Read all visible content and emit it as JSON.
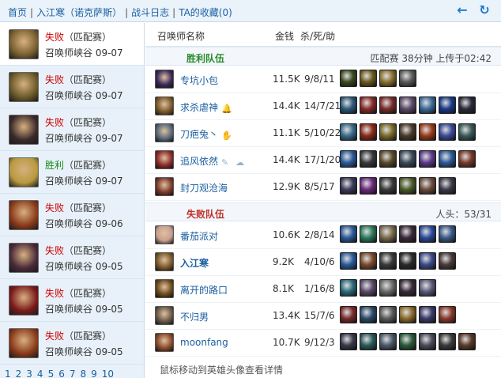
{
  "breadcrumb": {
    "home": "首页",
    "player": "入江寒（诺克萨斯）",
    "battle_log": "战斗日志",
    "favorites": "TA的收藏(0)"
  },
  "nav": {
    "back_icon": "arrow-left-icon",
    "refresh_icon": "refresh-icon"
  },
  "games": [
    {
      "result": "失败",
      "mode": "（匹配赛）",
      "info": "召唤师峡谷 09-07",
      "outcome": "loss",
      "color": "#7a6030"
    },
    {
      "result": "失败",
      "mode": "（匹配赛）",
      "info": "召唤师峡谷 09-07",
      "outcome": "loss",
      "color": "#6a5a2a"
    },
    {
      "result": "失败",
      "mode": "（匹配赛）",
      "info": "召唤师峡谷 09-07",
      "outcome": "loss",
      "color": "#3a2a2a"
    },
    {
      "result": "胜利",
      "mode": "（匹配赛）",
      "info": "召唤师峡谷 09-07",
      "outcome": "win",
      "color": "#b89a40"
    },
    {
      "result": "失败",
      "mode": "（匹配赛）",
      "info": "召唤师峡谷 09-06",
      "outcome": "loss",
      "color": "#8a3a1a"
    },
    {
      "result": "失败",
      "mode": "（匹配赛）",
      "info": "召唤师峡谷 09-05",
      "outcome": "loss",
      "color": "#4a2a3a"
    },
    {
      "result": "失败",
      "mode": "（匹配赛）",
      "info": "召唤师峡谷 09-05",
      "outcome": "loss",
      "color": "#7a1a1a"
    },
    {
      "result": "失败",
      "mode": "（匹配赛）",
      "info": "召唤师峡谷 09-05",
      "outcome": "loss",
      "color": "#8a3a1a"
    }
  ],
  "pager": [
    "1",
    "2",
    "3",
    "4",
    "5",
    "6",
    "7",
    "8",
    "9",
    "10"
  ],
  "columns": {
    "name": "召唤师名称",
    "gold": "金钱",
    "kda": "杀/死/助"
  },
  "win_team": {
    "label": "胜利队伍",
    "meta": "匹配赛 38分钟 上传于02:42",
    "players": [
      {
        "name": "专坑小包",
        "gold": "11.5K",
        "kda": "9/8/11",
        "badges": [],
        "champ_color": "#3a2a5a",
        "items": [
          "#3a4a20",
          "#6a5a20",
          "#8a7030",
          "#5a5a5a"
        ]
      },
      {
        "name": "求杀虐神",
        "gold": "14.4K",
        "kda": "14/7/21",
        "badges": [
          "bell-icon"
        ],
        "champ_color": "#7a5a2a",
        "items": [
          "#2a5a7a",
          "#8a2a2a",
          "#7a2a2a",
          "#5a4a6a",
          "#3a6a9a",
          "#1a3a8a",
          "#2a2a3a"
        ]
      },
      {
        "name": "刀疤兔丶",
        "gold": "11.1K",
        "kda": "5/10/22",
        "badges": [
          "hand-icon"
        ],
        "champ_color": "#5a6a7a",
        "items": [
          "#3a6a8a",
          "#8a2a1a",
          "#7a6a2a",
          "#4a3a2a",
          "#9a3a1a",
          "#3a4a9a",
          "#3a5a5a"
        ]
      },
      {
        "name": "追风依然",
        "gold": "14.4K",
        "kda": "17/1/20",
        "badges": [
          "feather-icon",
          "cloud-icon"
        ],
        "champ_color": "#8a2a2a",
        "items": [
          "#2a5a9a",
          "#3a3a3a",
          "#5a4a2a",
          "#3a4a5a",
          "#5a3a8a",
          "#2a5a9a",
          "#7a3a2a"
        ]
      },
      {
        "name": "封刀观沧海",
        "gold": "12.9K",
        "kda": "8/5/17",
        "badges": [],
        "champ_color": "#7a3a2a",
        "items": [
          "#3a3a5a",
          "#6a2a7a",
          "#3a3a3a",
          "#4a5a2a",
          "#6a4a3a",
          "#3a3a4a"
        ]
      }
    ]
  },
  "loss_team": {
    "label": "失败队伍",
    "meta": "人头：53/31",
    "players": [
      {
        "name": "番茄派对",
        "gold": "10.6K",
        "kda": "2/8/14",
        "bold": false,
        "champ_color": "#c8a090",
        "items": [
          "#2a5a9a",
          "#2a7a5a",
          "#7a6a4a",
          "#3a2a3a",
          "#2a4a9a",
          "#3a5a8a"
        ]
      },
      {
        "name": "入江寒",
        "gold": "9.2K",
        "kda": "4/10/6",
        "bold": true,
        "champ_color": "#7a5a2a",
        "items": [
          "#2a5a9a",
          "#7a4a2a",
          "#3a3a3a",
          "#2a2a2a",
          "#3a4a8a",
          "#4a3a3a"
        ]
      },
      {
        "name": "离开的路口",
        "gold": "8.1K",
        "kda": "1/16/8",
        "bold": false,
        "champ_color": "#6a4a1a",
        "items": [
          "#2a6a7a",
          "#5a4a6a",
          "#6a6a6a",
          "#3a2a3a",
          "#5a5a7a"
        ]
      },
      {
        "name": "不归男",
        "gold": "13.4K",
        "kda": "15/7/6",
        "bold": false,
        "champ_color": "#6a5a4a",
        "items": [
          "#7a2a2a",
          "#2a4a6a",
          "#5a5a5a",
          "#8a6a2a",
          "#3a3a6a",
          "#8a3a2a"
        ]
      },
      {
        "name": "moonfang",
        "gold": "10.7K",
        "kda": "9/12/3",
        "bold": false,
        "champ_color": "#8a4a2a",
        "items": [
          "#3a3a4a",
          "#2a5a5a",
          "#4a5a6a",
          "#2a5a3a",
          "#4a4a5a",
          "#3a3a3a",
          "#5a3a2a"
        ]
      }
    ]
  },
  "hint": "鼠标移动到英雄头像查看详情"
}
